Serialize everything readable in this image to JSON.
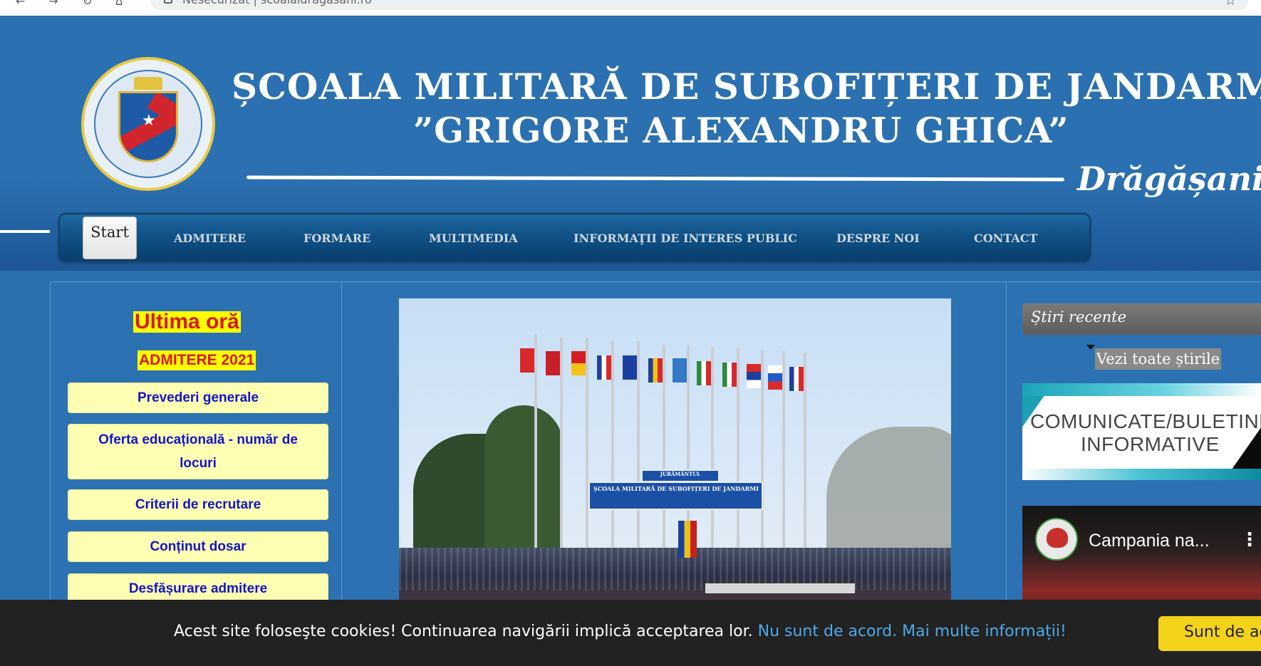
{
  "browser": {
    "url_prefix": "Nesecurizat",
    "url_text": "scoalaidragasani.ro"
  },
  "header": {
    "title": "ȘCOALA MILITARĂ DE SUBOFIȚERI DE JANDARMI",
    "subtitle": "”GRIGORE ALEXANDRU GHICA”",
    "city": "Drăgășani"
  },
  "menu": {
    "start": "Start",
    "items": [
      {
        "label": "ADMITERE"
      },
      {
        "label": "FORMARE"
      },
      {
        "label": "MULTIMEDIA"
      },
      {
        "label": "INFORMAŢII DE INTERES PUBLIC"
      },
      {
        "label": "DESPRE NOI"
      },
      {
        "label": "CONTACT"
      }
    ]
  },
  "sidebar": {
    "last_hour": "Ultima oră",
    "admission": "ADMITERE 2021",
    "buttons": [
      {
        "label": "Prevederi generale"
      },
      {
        "label": "Oferta educațională - număr de locuri"
      },
      {
        "label": "Criterii de recrutare"
      },
      {
        "label": "Conținut dosar"
      },
      {
        "label": "Desfășurare admitere"
      }
    ]
  },
  "photo": {
    "banner_top": "JURĂMÂNTUL",
    "banner_main": "ȘCOALA MILITARĂ DE SUBOFIȚERI DE JANDARMI"
  },
  "news": {
    "title": "Știri recente",
    "all_link": "Vezi toate știrile"
  },
  "bulletin": {
    "line1": "COMUNICATE/BULETINE",
    "line2": "INFORMATIVE"
  },
  "video": {
    "title": "Campania na..."
  },
  "cookies": {
    "message": "Acest site foloseşte cookies! Continuarea navigării implică acceptarea lor.",
    "decline": "Nu sunt de acord.",
    "more_info": "Mai multe informații!",
    "accept": "Sunt de acord"
  },
  "colors": {
    "header_bg": "#2b70b0",
    "menu_bg": "#105287",
    "side_button_bg": "#ffffb3",
    "side_button_text": "#1414c8",
    "highlight_yellow": "#ffff00",
    "alert_red": "#d81818",
    "cookie_bar_bg": "#222222",
    "cookie_link": "#4fa8e8",
    "cookie_accept_bg": "#f2d31a"
  }
}
